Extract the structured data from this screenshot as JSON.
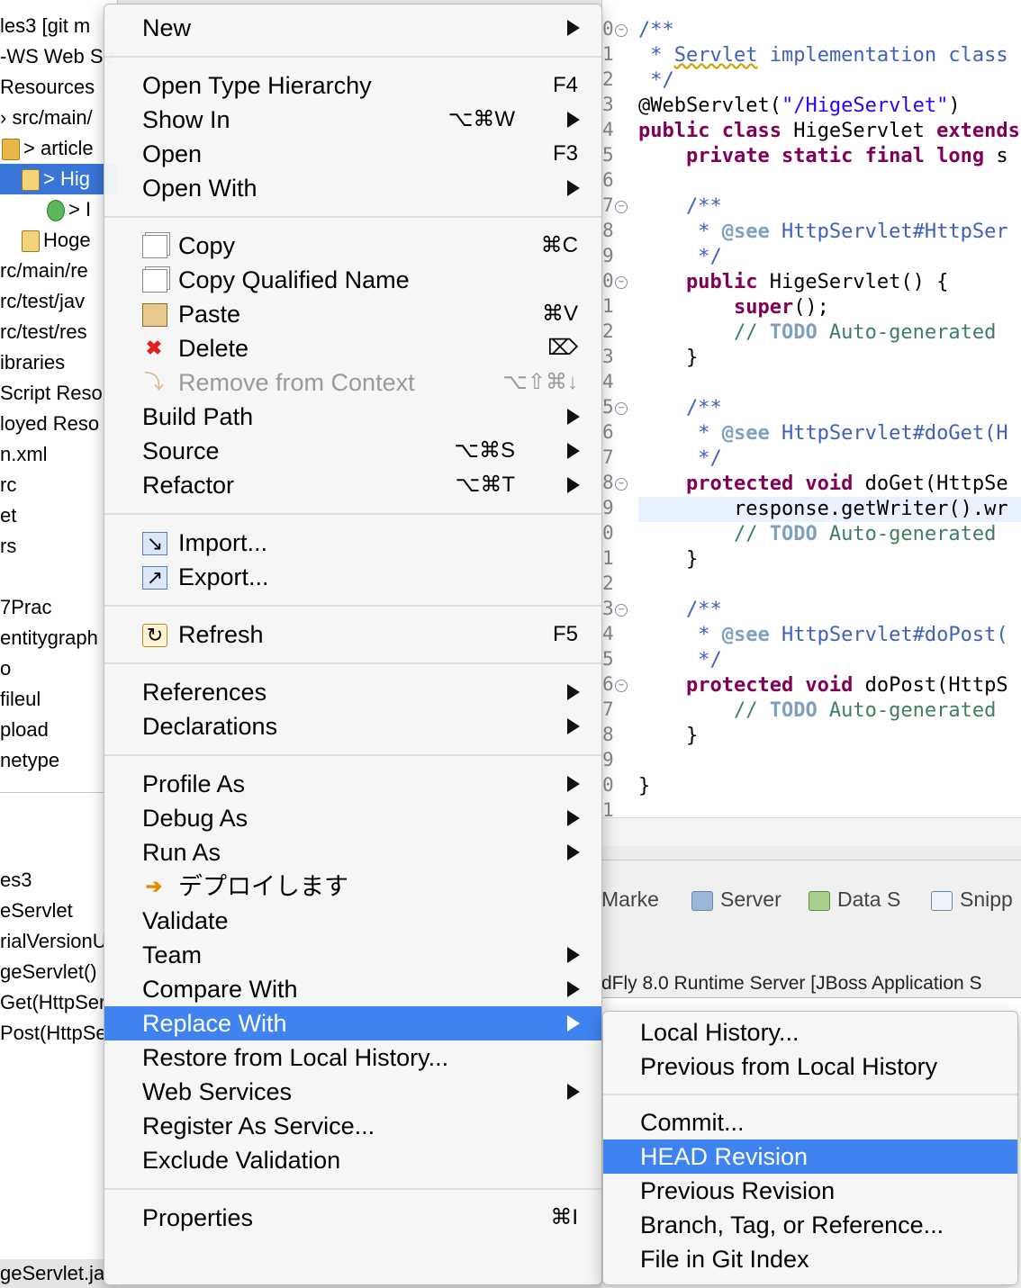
{
  "explorer": {
    "rows": [
      "les3  [git m",
      "-WS Web Se",
      "Resources",
      "› src/main/",
      "> article",
      "> Hig",
      "> I",
      "Hoge",
      "rc/main/re",
      "rc/test/jav",
      "rc/test/res",
      "ibraries",
      "Script Reso",
      "loyed Reso",
      "n.xml",
      "rc",
      "et",
      "rs",
      "",
      "7Prac",
      "entitygraph",
      "o",
      "fileul",
      "pload",
      "netype"
    ]
  },
  "outline": {
    "rows": [
      "es3",
      "eServlet",
      "rialVersionU",
      "geServlet()",
      "Get(HttpSer",
      "Post(HttpSe"
    ],
    "bottom_tab": "geServlet.ja"
  },
  "editor": {
    "line_numbers": [
      "0",
      "1",
      "2",
      "3",
      "4",
      "5",
      "6",
      "7",
      "8",
      "9",
      "0",
      "1",
      "2",
      "3",
      "4",
      "5",
      "6",
      "7",
      "8",
      "9",
      "0",
      "1",
      "2",
      "3",
      "4",
      "5",
      "6",
      "7",
      "8",
      "9",
      "0",
      "1"
    ],
    "lines": [
      {
        "parts": [
          [
            "cm",
            "/**"
          ]
        ]
      },
      {
        "parts": [
          [
            "cm",
            " * "
          ],
          [
            "cm",
            "Servlet"
          ],
          [
            "cm",
            " implementation class"
          ]
        ]
      },
      {
        "parts": [
          [
            "cm",
            " */"
          ]
        ]
      },
      {
        "parts": [
          [
            "",
            "@WebServlet("
          ],
          [
            "str",
            "\"/HigeServlet\""
          ],
          [
            "",
            ")"
          ]
        ]
      },
      {
        "parts": [
          [
            "kw",
            "public class"
          ],
          [
            "",
            " HigeServlet "
          ],
          [
            "kw",
            "extends"
          ]
        ]
      },
      {
        "parts": [
          [
            "",
            " "
          ],
          [
            "kw",
            "   private static final long"
          ],
          [
            "",
            " s"
          ]
        ]
      },
      {
        "parts": [
          [
            "",
            ""
          ]
        ]
      },
      {
        "parts": [
          [
            "cm",
            "    /**"
          ]
        ]
      },
      {
        "parts": [
          [
            "cm",
            "     * "
          ],
          [
            "tag",
            "@see"
          ],
          [
            "cm",
            " HttpServlet#HttpSer"
          ]
        ]
      },
      {
        "parts": [
          [
            "cm",
            "     */"
          ]
        ]
      },
      {
        "parts": [
          [
            "kw",
            "    public"
          ],
          [
            "",
            " HigeServlet() {"
          ]
        ]
      },
      {
        "parts": [
          [
            "kw",
            "        super"
          ],
          [
            "",
            "();"
          ]
        ]
      },
      {
        "parts": [
          [
            "cm2",
            "        // "
          ],
          [
            "todo",
            "TODO"
          ],
          [
            "cm2",
            " Auto-generated"
          ]
        ]
      },
      {
        "parts": [
          [
            "",
            "    }"
          ]
        ]
      },
      {
        "parts": [
          [
            "",
            ""
          ]
        ]
      },
      {
        "parts": [
          [
            "cm",
            "    /**"
          ]
        ]
      },
      {
        "parts": [
          [
            "cm",
            "     * "
          ],
          [
            "tag",
            "@see"
          ],
          [
            "cm",
            " HttpServlet#doGet(H"
          ]
        ]
      },
      {
        "parts": [
          [
            "cm",
            "     */"
          ]
        ]
      },
      {
        "parts": [
          [
            "kw",
            "    protected void"
          ],
          [
            "",
            " doGet(HttpSe"
          ]
        ]
      },
      {
        "parts": [
          [
            "",
            "        response.getWriter().wr"
          ]
        ]
      },
      {
        "parts": [
          [
            "cm2",
            "        // "
          ],
          [
            "todo",
            "TODO"
          ],
          [
            "cm2",
            " Auto-generated"
          ]
        ]
      },
      {
        "parts": [
          [
            "",
            "    }"
          ]
        ]
      },
      {
        "parts": [
          [
            "",
            ""
          ]
        ]
      },
      {
        "parts": [
          [
            "cm",
            "    /**"
          ]
        ]
      },
      {
        "parts": [
          [
            "cm",
            "     * "
          ],
          [
            "tag",
            "@see"
          ],
          [
            "cm",
            " HttpServlet#doPost("
          ]
        ]
      },
      {
        "parts": [
          [
            "cm",
            "     */"
          ]
        ]
      },
      {
        "parts": [
          [
            "kw",
            "    protected void"
          ],
          [
            "",
            " doPost(HttpS"
          ]
        ]
      },
      {
        "parts": [
          [
            "cm2",
            "        // "
          ],
          [
            "todo",
            "TODO"
          ],
          [
            "cm2",
            " Auto-generated"
          ]
        ]
      },
      {
        "parts": [
          [
            "",
            "    }"
          ]
        ]
      },
      {
        "parts": [
          [
            "",
            ""
          ]
        ]
      },
      {
        "parts": [
          [
            "",
            "}"
          ]
        ]
      },
      {
        "parts": [
          [
            "",
            ""
          ]
        ]
      }
    ]
  },
  "views": {
    "tabs": [
      "Marke",
      "Server",
      "Data S",
      "Snipp"
    ],
    "console_title": "dFly 8.0 Runtime Server [JBoss Application S"
  },
  "context_menu": {
    "items": [
      {
        "type": "item",
        "label": "New",
        "arrow": true
      },
      {
        "type": "sep"
      },
      {
        "type": "item",
        "label": "Open Type Hierarchy",
        "shortcut": "F4"
      },
      {
        "type": "item",
        "label": "Show In",
        "shortcut": "⌥⌘W",
        "arrow": true
      },
      {
        "type": "item",
        "label": "Open",
        "shortcut": "F3"
      },
      {
        "type": "item",
        "label": "Open With",
        "arrow": true
      },
      {
        "type": "sep"
      },
      {
        "type": "item",
        "label": "Copy",
        "shortcut": "⌘C",
        "icon": "copy-icon"
      },
      {
        "type": "item",
        "label": "Copy Qualified Name",
        "icon": "copy-qualified-icon"
      },
      {
        "type": "item",
        "label": "Paste",
        "shortcut": "⌘V",
        "icon": "paste-icon"
      },
      {
        "type": "item",
        "label": "Delete",
        "shortcut": "⌦",
        "icon": "delete-icon"
      },
      {
        "type": "item",
        "label": "Remove from Context",
        "shortcut": "⌥⇧⌘↓",
        "icon": "remove-context-icon",
        "disabled": true
      },
      {
        "type": "item",
        "label": "Build Path",
        "arrow": true
      },
      {
        "type": "item",
        "label": "Source",
        "shortcut": "⌥⌘S",
        "arrow": true
      },
      {
        "type": "item",
        "label": "Refactor",
        "shortcut": "⌥⌘T",
        "arrow": true
      },
      {
        "type": "sep"
      },
      {
        "type": "item",
        "label": "Import...",
        "icon": "import-icon"
      },
      {
        "type": "item",
        "label": "Export...",
        "icon": "export-icon"
      },
      {
        "type": "sep"
      },
      {
        "type": "item",
        "label": "Refresh",
        "shortcut": "F5",
        "icon": "refresh-icon"
      },
      {
        "type": "sep"
      },
      {
        "type": "item",
        "label": "References",
        "arrow": true
      },
      {
        "type": "item",
        "label": "Declarations",
        "arrow": true
      },
      {
        "type": "sep"
      },
      {
        "type": "item",
        "label": "Profile As",
        "arrow": true
      },
      {
        "type": "item",
        "label": "Debug As",
        "arrow": true
      },
      {
        "type": "item",
        "label": "Run As",
        "arrow": true
      },
      {
        "type": "item",
        "label": "デプロイします",
        "icon": "deploy-icon"
      },
      {
        "type": "item",
        "label": "Validate"
      },
      {
        "type": "item",
        "label": "Team",
        "arrow": true
      },
      {
        "type": "item",
        "label": "Compare With",
        "arrow": true
      },
      {
        "type": "item",
        "label": "Replace With",
        "arrow": true,
        "highlighted": true
      },
      {
        "type": "item",
        "label": "Restore from Local History..."
      },
      {
        "type": "item",
        "label": "Web Services",
        "arrow": true
      },
      {
        "type": "item",
        "label": "Register As Service..."
      },
      {
        "type": "item",
        "label": "Exclude Validation"
      },
      {
        "type": "sep"
      },
      {
        "type": "item",
        "label": "Properties",
        "shortcut": "⌘I"
      }
    ]
  },
  "submenu": {
    "items": [
      {
        "type": "item",
        "label": "Local History..."
      },
      {
        "type": "item",
        "label": "Previous from Local History"
      },
      {
        "type": "sep"
      },
      {
        "type": "item",
        "label": "Commit..."
      },
      {
        "type": "item",
        "label": "HEAD Revision",
        "highlighted": true
      },
      {
        "type": "item",
        "label": "Previous Revision"
      },
      {
        "type": "item",
        "label": "Branch, Tag, or Reference..."
      },
      {
        "type": "item",
        "label": "File in Git Index"
      }
    ]
  },
  "colors": {
    "highlight": "#3f83f1",
    "keyword": "#7f0055",
    "javadoc": "#3f5fbf",
    "string": "#2a00ff"
  }
}
